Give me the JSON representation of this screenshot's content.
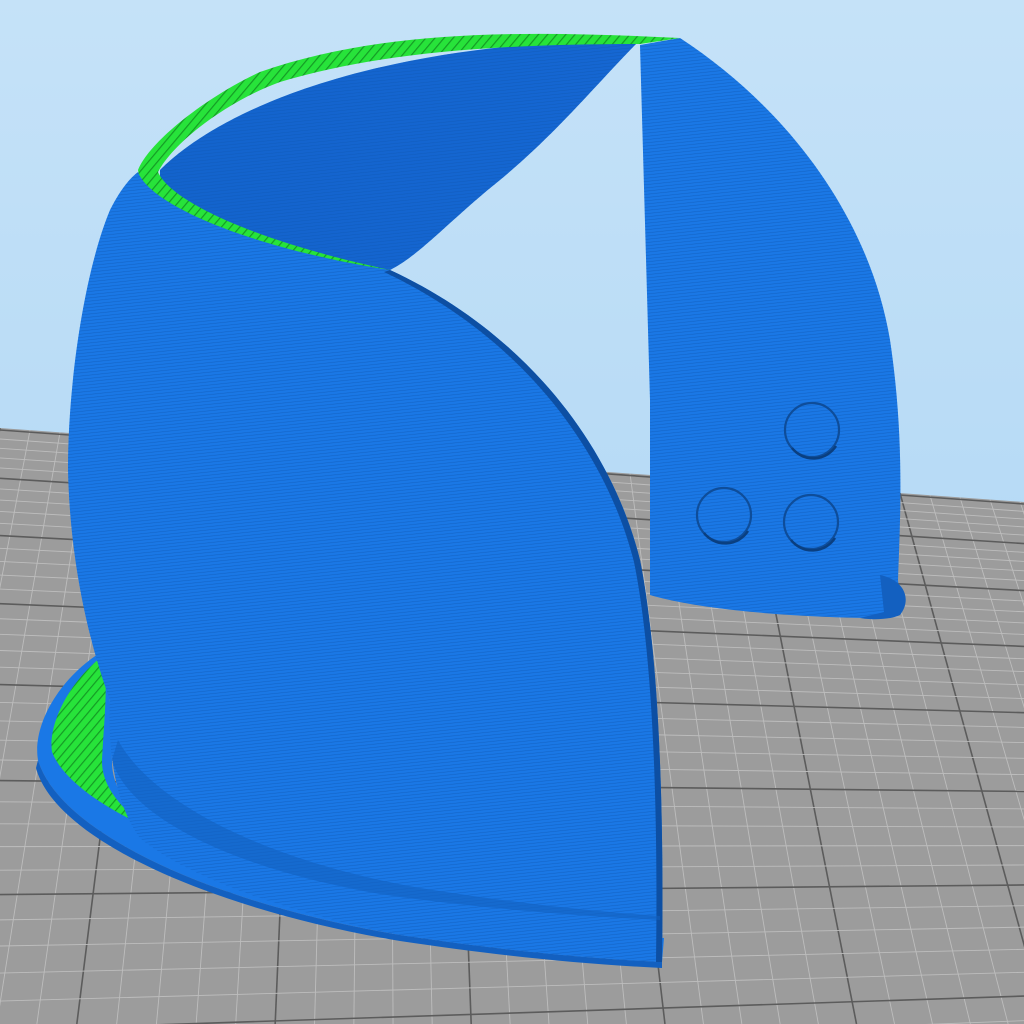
{
  "viewport": {
    "sky_top_color": "#c5e2f8",
    "sky_bottom_color": "#a9d3f3",
    "bed_color": "#9c9c9c",
    "bed_minor_grid_color": "#bdbdbd",
    "bed_major_grid_color": "#5c5c5c",
    "model_wall_color": "#1a78e6",
    "model_wall_shadow_color": "#1360c0",
    "model_layer_line_color": "#0e55ad",
    "infill_color": "#27e33a",
    "infill_stripe_color": "#159a25",
    "model_features": {
      "type": "helmet-shell-sliced-preview",
      "mounting_holes": 3,
      "brim_flange": true
    }
  }
}
